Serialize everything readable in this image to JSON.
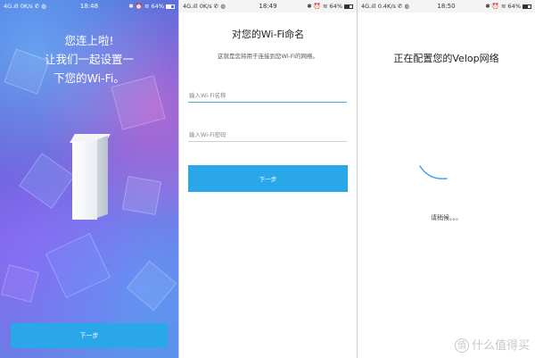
{
  "status_bars": [
    {
      "left": "4G.ıll 0K/s ✆ ◍",
      "time": "18:48",
      "right": "✱ ⏰ ≋ 64%",
      "battery_pct": 64
    },
    {
      "left": "4G.ıll 0K/s ✆ ◍",
      "time": "18:49",
      "right": "✱ ⏰ ≋ 64%",
      "battery_pct": 64
    },
    {
      "left": "4G.ıll 0.4K/s ✆ ◍",
      "time": "18:50",
      "right": "✱ ⏰ ≋ 64%",
      "battery_pct": 64
    }
  ],
  "screen1": {
    "line1": "您连上啦!",
    "line2": "让我们一起设置一",
    "line3": "下您的Wi-Fi。",
    "next_button": "下一步"
  },
  "screen2": {
    "title": "对您的Wi-Fi命名",
    "subtitle": "这就是您将用于连接到您Wi-Fi的网络。",
    "ssid_placeholder": "输入Wi-Fi名称",
    "password_placeholder": "输入Wi-Fi密码",
    "next_button": "下一步"
  },
  "screen3": {
    "title": "正在配置您的Velop网络",
    "waiting": "请稍候。。。",
    "spinner_color": "#3ba3e6"
  },
  "watermark": {
    "badge": "值",
    "text": "什么值得买"
  },
  "colors": {
    "accent": "#2aa7e8"
  }
}
